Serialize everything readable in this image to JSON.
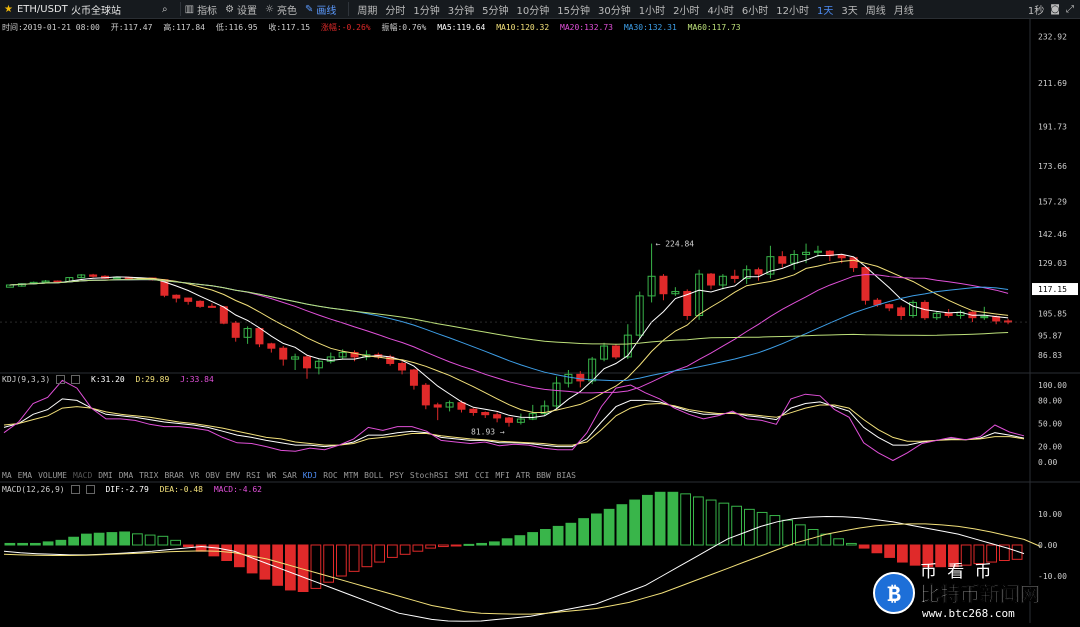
{
  "toolbar": {
    "pair": "ETH/USDT",
    "exchange": "火币全球站",
    "tools": [
      {
        "label": "指标",
        "icon": "chart-icon"
      },
      {
        "label": "设置",
        "icon": "gear-icon"
      },
      {
        "label": "亮色",
        "icon": "sun-icon"
      },
      {
        "label": "画线",
        "icon": "pen-icon",
        "active": true
      }
    ],
    "periods": [
      "周期",
      "分时",
      "1分钟",
      "3分钟",
      "5分钟",
      "10分钟",
      "15分钟",
      "30分钟",
      "1小时",
      "2小时",
      "4小时",
      "6小时",
      "12小时",
      "1天",
      "3天",
      "周线",
      "月线"
    ],
    "active_period": "1天",
    "countdown": "1秒"
  },
  "info": {
    "time": "时间:2019-01-21 08:00",
    "open": "开:117.47",
    "high": "高:117.84",
    "low": "低:116.95",
    "close": "收:117.15",
    "change": "涨幅:-0.26%",
    "amplitude": "振幅:0.76%",
    "ma5": "MA5:119.64",
    "ma10": "MA10:120.32",
    "ma20": "MA20:132.73",
    "ma30": "MA30:132.31",
    "ma60": "MA60:117.73"
  },
  "colors": {
    "up": "#39b54a",
    "down": "#e02a2a",
    "ma5": "#ffffff",
    "ma10": "#f2e07a",
    "ma20": "#e050d8",
    "ma30": "#3d9ee6",
    "ma60": "#bde07a",
    "active": "#4e8cf2"
  },
  "price_axis": [
    "232.92",
    "211.69",
    "191.73",
    "173.66",
    "157.29",
    "142.46",
    "129.03",
    "117.15",
    "105.85",
    "95.87",
    "86.83"
  ],
  "price_marks": {
    "high": "← 224.84",
    "low": "81.93 →",
    "current": "117.15"
  },
  "kdj": {
    "title": "KDJ(9,3,3)",
    "k": "K:31.20",
    "d": "D:29.89",
    "j": "J:33.84",
    "axis": [
      "100.00",
      "80.00",
      "50.00",
      "20.00",
      "0.00"
    ]
  },
  "indicators": [
    "MA",
    "EMA",
    "VOLUME",
    "MACD",
    "DMI",
    "DMA",
    "TRIX",
    "BRAR",
    "VR",
    "OBV",
    "EMV",
    "RSI",
    "WR",
    "SAR",
    "KDJ",
    "ROC",
    "MTM",
    "BOLL",
    "PSY",
    "StochRSI",
    "SMI",
    "CCI",
    "MFI",
    "ATR",
    "BBW",
    "BIAS"
  ],
  "active_indicator": "KDJ",
  "macd": {
    "title": "MACD(12,26,9)",
    "dif": "DIF:-2.79",
    "dea": "DEA:-0.48",
    "macd": "MACD:-4.62",
    "axis": [
      "10.00",
      "0.00",
      "-10.00"
    ]
  },
  "watermark": {
    "title": "币 看 币",
    "site_name": "比特币新闻网",
    "url": "www.btc268.com"
  },
  "candles": [
    [
      0,
      1,
      0.5,
      1.2
    ],
    [
      0.5,
      1.6,
      0.2,
      1.8
    ],
    [
      1.6,
      2.2,
      1.2,
      2.6
    ],
    [
      2.2,
      2.8,
      2.0,
      3.3
    ],
    [
      2.8,
      2.6,
      2.1,
      3.1
    ],
    [
      2.6,
      4.4,
      2.4,
      4.6
    ],
    [
      4.4,
      5.6,
      4.0,
      6.0
    ],
    [
      5.6,
      5.0,
      4.5,
      6.1
    ],
    [
      5.0,
      4.1,
      3.8,
      5.5
    ],
    [
      4.1,
      4.5,
      3.9,
      4.8
    ],
    [
      4.5,
      3.8,
      3.6,
      4.9
    ],
    [
      3.8,
      4.2,
      3.5,
      4.4
    ],
    [
      4.2,
      3.4,
      3.0,
      4.4
    ],
    [
      3.4,
      -3.7,
      -4.6,
      3.6
    ],
    [
      -3.7,
      -5.0,
      -7.0,
      -3.3
    ],
    [
      -5.0,
      -6.5,
      -8.0,
      -4.8
    ],
    [
      -6.5,
      -8.8,
      -9.5,
      -6.0
    ],
    [
      -8.8,
      -9.0,
      -9.4,
      -7.4
    ],
    [
      -9.0,
      -16.5,
      -17.0,
      -8.6
    ],
    [
      -16.5,
      -23.0,
      -25.0,
      -15.5
    ],
    [
      -23.0,
      -19.0,
      -26.0,
      -18.0
    ],
    [
      -19.0,
      -26.0,
      -27.5,
      -18.5
    ],
    [
      -26.0,
      -28.0,
      -30.0,
      -25.5
    ],
    [
      -28.0,
      -33.0,
      -36.0,
      -27.0
    ],
    [
      -33.0,
      -32.0,
      -38.0,
      -30.5
    ],
    [
      -32.0,
      -37.0,
      -42.0,
      -31.0
    ],
    [
      -37.0,
      -34.0,
      -40.0,
      -33.0
    ],
    [
      -34.0,
      -32.0,
      -35.0,
      -30.0
    ],
    [
      -32.0,
      -30.0,
      -33.0,
      -28.5
    ],
    [
      -30.0,
      -32.0,
      -34.0,
      -29.0
    ],
    [
      -32.0,
      -31.0,
      -33.5,
      -29.0
    ],
    [
      -31.0,
      -32.0,
      -33.0,
      -30.0
    ],
    [
      -32.0,
      -35.0,
      -36.0,
      -31.0
    ],
    [
      -35.0,
      -38.0,
      -40.0,
      -34.0
    ],
    [
      -38.0,
      -45.0,
      -47.0,
      -37.5
    ],
    [
      -45.0,
      -54.0,
      -56.0,
      -44.0
    ],
    [
      -54.0,
      -55.0,
      -61.0,
      -53.0
    ],
    [
      -55.0,
      -53.0,
      -57.0,
      -52.0
    ],
    [
      -53.0,
      -56.0,
      -57.5,
      -52.0
    ],
    [
      -56.0,
      -57.5,
      -59.0,
      -55.5
    ],
    [
      -57.5,
      -58.5,
      -60.0,
      -57.0
    ],
    [
      -58.5,
      -60.0,
      -62.0,
      -57.5
    ],
    [
      -60.0,
      -62.0,
      -64.0,
      -59.5
    ],
    [
      -62.0,
      -60.5,
      -63.0,
      -58.0
    ],
    [
      -60.5,
      -58.0,
      -61.0,
      -54.0
    ],
    [
      -58.0,
      -54.5,
      -59.0,
      -52.0
    ],
    [
      -54.5,
      -44.0,
      -56.0,
      -41.0
    ],
    [
      -44.0,
      -40.0,
      -46.0,
      -38.0
    ],
    [
      -40.0,
      -43.0,
      -46.0,
      -38.5
    ],
    [
      -43.0,
      -33.0,
      -44.5,
      -32.0
    ],
    [
      -33.0,
      -27.0,
      -34.0,
      -25.5
    ],
    [
      -27.0,
      -32.0,
      -33.0,
      -26.0
    ],
    [
      -32.0,
      -22.0,
      -33.0,
      -17.0
    ],
    [
      -22.0,
      -4.0,
      -24.0,
      -2.0
    ],
    [
      -4.0,
      5.0,
      -7.0,
      20.0
    ],
    [
      5.0,
      -3.0,
      -6.0,
      6.0
    ],
    [
      -3.0,
      -2.0,
      -4.0,
      0.0
    ],
    [
      -2.0,
      -13.0,
      -15.0,
      -1.0
    ],
    [
      -13.0,
      6.0,
      -15.0,
      8.0
    ],
    [
      6.0,
      1.0,
      -1.0,
      6.5
    ],
    [
      1.0,
      5.0,
      -1.0,
      6.0
    ],
    [
      5.0,
      4.0,
      2.0,
      8.0
    ],
    [
      4.0,
      8.0,
      1.5,
      10.0
    ],
    [
      8.0,
      6.0,
      3.0,
      9.0
    ],
    [
      6.0,
      14.0,
      4.0,
      19.0
    ],
    [
      14.0,
      11.0,
      9.0,
      16.5
    ],
    [
      11.0,
      15.0,
      8.0,
      17.0
    ],
    [
      15.0,
      16.0,
      11.0,
      20.0
    ],
    [
      16.0,
      16.5,
      14.0,
      19.0
    ],
    [
      16.5,
      14.5,
      12.0,
      17.0
    ],
    [
      14.5,
      13.5,
      11.0,
      15.0
    ],
    [
      13.5,
      9.0,
      7.0,
      14.0
    ],
    [
      9.0,
      -6.0,
      -8.0,
      9.5
    ],
    [
      -6.0,
      -8.0,
      -9.0,
      -5.0
    ],
    [
      -8.0,
      -9.5,
      -11.0,
      -7.5
    ],
    [
      -9.5,
      -13.0,
      -15.0,
      -8.5
    ],
    [
      -13.0,
      -7.0,
      -14.0,
      -6.0
    ],
    [
      -7.0,
      -14.0,
      -15.0,
      -6.0
    ],
    [
      -14.0,
      -12.0,
      -15.0,
      -11.0
    ],
    [
      -12.0,
      -13.0,
      -14.0,
      -10.0
    ],
    [
      -13.0,
      -11.5,
      -14.5,
      -10.5
    ],
    [
      -11.5,
      -14.0,
      -16.0,
      -11.0
    ],
    [
      -14.0,
      -13.5,
      -15.0,
      -9.0
    ],
    [
      -13.5,
      -15.5,
      -17.0,
      -13.0
    ],
    [
      -15.5,
      -16.0,
      -17.0,
      -14.5
    ]
  ],
  "kdj_lines": {
    "k": [
      45,
      50,
      62,
      68,
      82,
      80,
      70,
      62,
      60,
      58,
      55,
      52,
      50,
      48,
      45,
      40,
      35,
      32,
      28,
      25,
      22,
      22,
      20,
      22,
      26,
      35,
      35,
      38,
      40,
      38,
      32,
      30,
      28,
      28,
      25,
      25,
      24,
      22,
      20,
      20,
      30,
      52,
      72,
      80,
      80,
      78,
      72,
      66,
      62,
      62,
      64,
      60,
      58,
      55,
      70,
      76,
      78,
      72,
      66,
      45,
      32,
      22,
      22,
      26,
      28,
      30,
      29,
      31,
      38,
      35,
      31
    ],
    "d": [
      48,
      50,
      55,
      60,
      70,
      72,
      70,
      65,
      62,
      60,
      58,
      55,
      52,
      50,
      47,
      44,
      40,
      36,
      32,
      30,
      26,
      24,
      22,
      22,
      24,
      30,
      32,
      34,
      37,
      37,
      34,
      32,
      30,
      29,
      27,
      26,
      25,
      24,
      22,
      22,
      26,
      42,
      60,
      70,
      75,
      76,
      73,
      68,
      65,
      63,
      63,
      62,
      60,
      58,
      64,
      70,
      74,
      74,
      70,
      55,
      42,
      32,
      27,
      27,
      28,
      29,
      29,
      30,
      33,
      33,
      30
    ],
    "j": [
      38,
      52,
      76,
      84,
      106,
      96,
      70,
      56,
      56,
      54,
      49,
      46,
      46,
      44,
      41,
      32,
      25,
      24,
      20,
      15,
      14,
      18,
      16,
      22,
      30,
      45,
      41,
      46,
      46,
      40,
      28,
      26,
      24,
      26,
      21,
      23,
      22,
      18,
      16,
      16,
      38,
      72,
      96,
      100,
      90,
      82,
      70,
      62,
      56,
      60,
      66,
      56,
      54,
      49,
      82,
      88,
      86,
      68,
      58,
      25,
      12,
      2,
      12,
      24,
      28,
      32,
      29,
      33,
      48,
      39,
      34
    ]
  },
  "macd_hist": [
    0.5,
    0.5,
    0.5,
    1.0,
    1.5,
    2.5,
    3.5,
    3.8,
    4.0,
    4.2,
    3.6,
    3.2,
    2.8,
    1.5,
    -0.5,
    -2.0,
    -3.5,
    -5.0,
    -7.0,
    -9.0,
    -11.0,
    -13.0,
    -14.5,
    -15.0,
    -14.0,
    -12.0,
    -10.0,
    -8.5,
    -7.0,
    -5.5,
    -4.0,
    -3.0,
    -2.0,
    -1.0,
    -0.5,
    -0.2,
    0.2,
    0.5,
    1.0,
    2.0,
    3.0,
    4.0,
    5.0,
    6.0,
    7.0,
    8.5,
    10.0,
    11.5,
    13.0,
    14.5,
    16.0,
    17.0,
    17.0,
    16.5,
    15.5,
    14.5,
    13.5,
    12.5,
    11.5,
    10.5,
    9.5,
    8.0,
    6.5,
    5.0,
    3.5,
    2.0,
    0.5,
    -1.0,
    -2.5,
    -4.0,
    -5.5,
    -6.5,
    -7.0,
    -7.0,
    -7.0,
    -6.5,
    -6.0,
    -5.5,
    -5.0,
    -4.62
  ],
  "macd_dif": [
    -2,
    -2.5,
    -2.8,
    -3,
    -3.2,
    -3.2,
    -3,
    -2.7,
    -2.4,
    -2,
    -1.5,
    -1,
    -0.5,
    -1,
    -2,
    -4,
    -6,
    -8,
    -10,
    -12,
    -14,
    -16,
    -18,
    -20,
    -22,
    -23,
    -24,
    -24.5,
    -24.6,
    -24.5,
    -24,
    -23.5,
    -23,
    -22,
    -21,
    -20,
    -19,
    -17,
    -15,
    -13,
    -10,
    -7,
    -4,
    -1,
    2,
    4,
    6,
    7.5,
    8.5,
    9,
    9.2,
    9.1,
    8.8,
    8.2,
    7.5,
    6.5,
    5.5,
    4.5,
    3.5,
    2,
    0.5,
    -1,
    -2.79
  ],
  "macd_dea": [
    -3,
    -3.2,
    -3.3,
    -3.4,
    -3.4,
    -3.3,
    -3.1,
    -2.9,
    -2.7,
    -2.5,
    -2.2,
    -2,
    -1.9,
    -2,
    -2.5,
    -3.5,
    -4.5,
    -6,
    -7.5,
    -9,
    -10.5,
    -12,
    -13.5,
    -15,
    -16.5,
    -18,
    -19.5,
    -20.5,
    -21.5,
    -22,
    -22.2,
    -22.3,
    -22.3,
    -22,
    -21.5,
    -21,
    -20.5,
    -19.5,
    -18.5,
    -17,
    -15.5,
    -13.5,
    -11.5,
    -9.5,
    -7.5,
    -5.5,
    -3.5,
    -1.5,
    0.5,
    2,
    3.5,
    4.5,
    5.5,
    6.2,
    6.6,
    6.8,
    6.8,
    6.5,
    6,
    5.2,
    4.2,
    3,
    1.8,
    -0.48
  ]
}
